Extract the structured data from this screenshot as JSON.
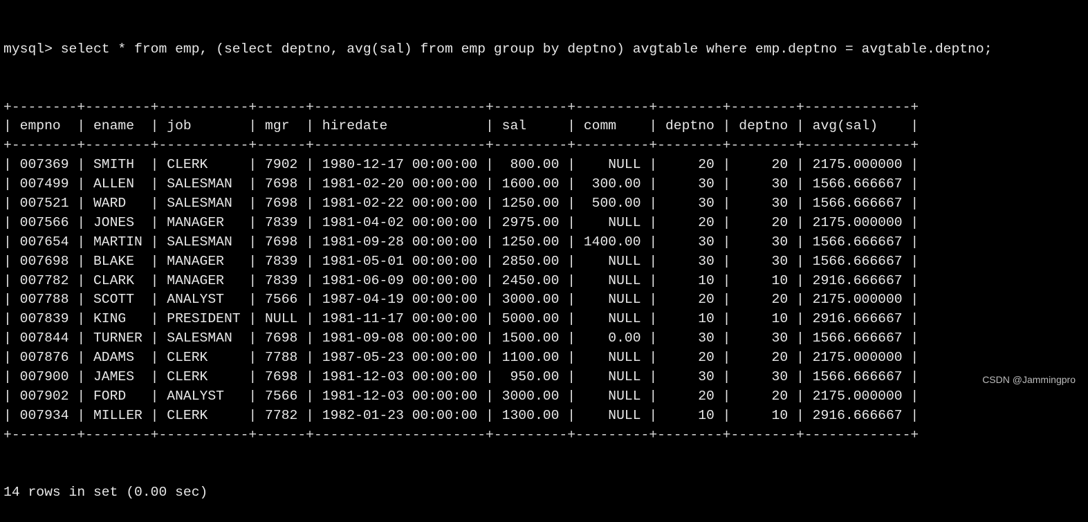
{
  "terminal": {
    "prompt": "mysql> ",
    "command": "select * from emp, (select deptno, avg(sal) from emp group by deptno) avgtable where emp.deptno = avgtable.deptno;",
    "result_table": {
      "columns": [
        {
          "name": "empno",
          "width": 6,
          "align": "left"
        },
        {
          "name": "ename",
          "width": 6,
          "align": "left"
        },
        {
          "name": "job",
          "width": 9,
          "align": "left"
        },
        {
          "name": "mgr",
          "width": 4,
          "align": "left"
        },
        {
          "name": "hiredate",
          "width": 19,
          "align": "left"
        },
        {
          "name": "sal",
          "width": 7,
          "align": "right"
        },
        {
          "name": "comm",
          "width": 7,
          "align": "right"
        },
        {
          "name": "deptno",
          "width": 6,
          "align": "right"
        },
        {
          "name": "deptno",
          "width": 6,
          "align": "right"
        },
        {
          "name": "avg(sal)",
          "width": 11,
          "align": "left"
        }
      ],
      "rows": [
        [
          "007369",
          "SMITH",
          "CLERK",
          "7902",
          "1980-12-17 00:00:00",
          "800.00",
          "NULL",
          "20",
          "20",
          "2175.000000"
        ],
        [
          "007499",
          "ALLEN",
          "SALESMAN",
          "7698",
          "1981-02-20 00:00:00",
          "1600.00",
          "300.00",
          "30",
          "30",
          "1566.666667"
        ],
        [
          "007521",
          "WARD",
          "SALESMAN",
          "7698",
          "1981-02-22 00:00:00",
          "1250.00",
          "500.00",
          "30",
          "30",
          "1566.666667"
        ],
        [
          "007566",
          "JONES",
          "MANAGER",
          "7839",
          "1981-04-02 00:00:00",
          "2975.00",
          "NULL",
          "20",
          "20",
          "2175.000000"
        ],
        [
          "007654",
          "MARTIN",
          "SALESMAN",
          "7698",
          "1981-09-28 00:00:00",
          "1250.00",
          "1400.00",
          "30",
          "30",
          "1566.666667"
        ],
        [
          "007698",
          "BLAKE",
          "MANAGER",
          "7839",
          "1981-05-01 00:00:00",
          "2850.00",
          "NULL",
          "30",
          "30",
          "1566.666667"
        ],
        [
          "007782",
          "CLARK",
          "MANAGER",
          "7839",
          "1981-06-09 00:00:00",
          "2450.00",
          "NULL",
          "10",
          "10",
          "2916.666667"
        ],
        [
          "007788",
          "SCOTT",
          "ANALYST",
          "7566",
          "1987-04-19 00:00:00",
          "3000.00",
          "NULL",
          "20",
          "20",
          "2175.000000"
        ],
        [
          "007839",
          "KING",
          "PRESIDENT",
          "NULL",
          "1981-11-17 00:00:00",
          "5000.00",
          "NULL",
          "10",
          "10",
          "2916.666667"
        ],
        [
          "007844",
          "TURNER",
          "SALESMAN",
          "7698",
          "1981-09-08 00:00:00",
          "1500.00",
          "0.00",
          "30",
          "30",
          "1566.666667"
        ],
        [
          "007876",
          "ADAMS",
          "CLERK",
          "7788",
          "1987-05-23 00:00:00",
          "1100.00",
          "NULL",
          "20",
          "20",
          "2175.000000"
        ],
        [
          "007900",
          "JAMES",
          "CLERK",
          "7698",
          "1981-12-03 00:00:00",
          "950.00",
          "NULL",
          "30",
          "30",
          "1566.666667"
        ],
        [
          "007902",
          "FORD",
          "ANALYST",
          "7566",
          "1981-12-03 00:00:00",
          "3000.00",
          "NULL",
          "20",
          "20",
          "2175.000000"
        ],
        [
          "007934",
          "MILLER",
          "CLERK",
          "7782",
          "1982-01-23 00:00:00",
          "1300.00",
          "NULL",
          "10",
          "10",
          "2916.666667"
        ]
      ]
    },
    "status": "14 rows in set (0.00 sec)"
  },
  "watermark": "CSDN @Jammingpro",
  "colors": {
    "background": "#000000",
    "text": "#e8e8e8",
    "watermark": "#bdbdbd"
  }
}
